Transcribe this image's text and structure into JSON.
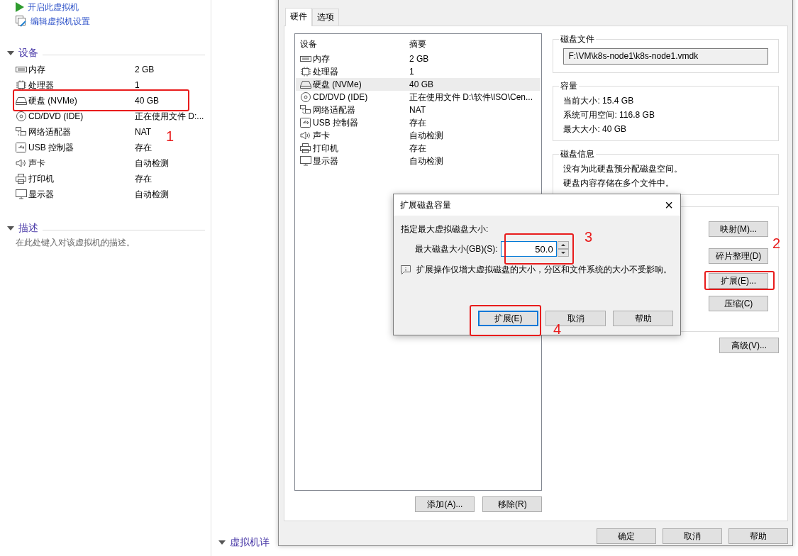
{
  "sidebar": {
    "actions": [
      {
        "label": "开启此虚拟机",
        "kind": "play"
      },
      {
        "label": "编辑虚拟机设置",
        "kind": "edit"
      }
    ],
    "devices_section": {
      "title": "设备",
      "expanded": true,
      "items": [
        {
          "name": "内存",
          "value": "2 GB",
          "kind": "memory"
        },
        {
          "name": "处理器",
          "value": "1",
          "kind": "cpu"
        },
        {
          "name": "硬盘 (NVMe)",
          "value": "40 GB",
          "kind": "disk"
        },
        {
          "name": "CD/DVD (IDE)",
          "value": "正在使用文件 D:...",
          "kind": "cd"
        },
        {
          "name": "网络适配器",
          "value": "NAT",
          "kind": "network"
        },
        {
          "name": "USB 控制器",
          "value": "存在",
          "kind": "usb"
        },
        {
          "name": "声卡",
          "value": "自动检测",
          "kind": "sound"
        },
        {
          "name": "打印机",
          "value": "存在",
          "kind": "printer"
        },
        {
          "name": "显示器",
          "value": "自动检测",
          "kind": "monitor"
        }
      ]
    },
    "description_section": {
      "title": "描述",
      "expanded": true,
      "text": "在此处键入对该虚拟机的描述。"
    },
    "details_section": {
      "title": "虚拟机详",
      "expanded": true
    }
  },
  "settings_dialog": {
    "tabs": [
      {
        "label": "硬件",
        "selected": true
      },
      {
        "label": "选项",
        "selected": false
      }
    ],
    "device_list": {
      "columns": [
        "设备",
        "摘要"
      ],
      "rows": [
        {
          "name": "内存",
          "summary": "2 GB",
          "kind": "memory",
          "selected": false
        },
        {
          "name": "处理器",
          "summary": "1",
          "kind": "cpu",
          "selected": false
        },
        {
          "name": "硬盘 (NVMe)",
          "summary": "40 GB",
          "kind": "disk",
          "selected": true
        },
        {
          "name": "CD/DVD (IDE)",
          "summary": "正在使用文件 D:\\软件\\ISO\\Cen...",
          "kind": "cd",
          "selected": false
        },
        {
          "name": "网络适配器",
          "summary": "NAT",
          "kind": "network",
          "selected": false
        },
        {
          "name": "USB 控制器",
          "summary": "存在",
          "kind": "usb",
          "selected": false
        },
        {
          "name": "声卡",
          "summary": "自动检测",
          "kind": "sound",
          "selected": false
        },
        {
          "name": "打印机",
          "summary": "存在",
          "kind": "printer",
          "selected": false
        },
        {
          "name": "显示器",
          "summary": "自动检测",
          "kind": "monitor",
          "selected": false
        }
      ]
    },
    "list_buttons": [
      "添加(A)...",
      "移除(R)"
    ],
    "disk_file": {
      "title": "磁盘文件",
      "path": "F:\\VM\\k8s-node1\\k8s-node1.vmdk"
    },
    "capacity": {
      "title": "容量",
      "lines": [
        "当前大小: 15.4 GB",
        "系统可用空间: 116.8 GB",
        "最大大小: 40 GB"
      ]
    },
    "disk_info": {
      "title": "磁盘信息",
      "lines": [
        "没有为此硬盘预分配磁盘空间。",
        "硬盘内容存储在多个文件中。"
      ]
    },
    "utility_buttons": [
      "映射(M)...",
      "碎片整理(D)",
      "扩展(E)...",
      "压缩(C)"
    ],
    "advanced_button": "高级(V)...",
    "buttons": [
      "确定",
      "取消",
      "帮助"
    ]
  },
  "expand_dialog": {
    "title": "扩展磁盘容量",
    "close": "×",
    "prompt": "指定最大虚拟磁盘大小:",
    "size_label": "最大磁盘大小(GB)(S):",
    "size_value": "50.0",
    "note": "扩展操作仅增大虚拟磁盘的大小，分区和文件系统的大小不受影响。",
    "buttons": [
      {
        "label": "扩展(E)",
        "default": true
      },
      {
        "label": "取消",
        "default": false
      },
      {
        "label": "帮助",
        "default": false
      }
    ]
  },
  "annotations": [
    "1",
    "2",
    "3",
    "4"
  ]
}
